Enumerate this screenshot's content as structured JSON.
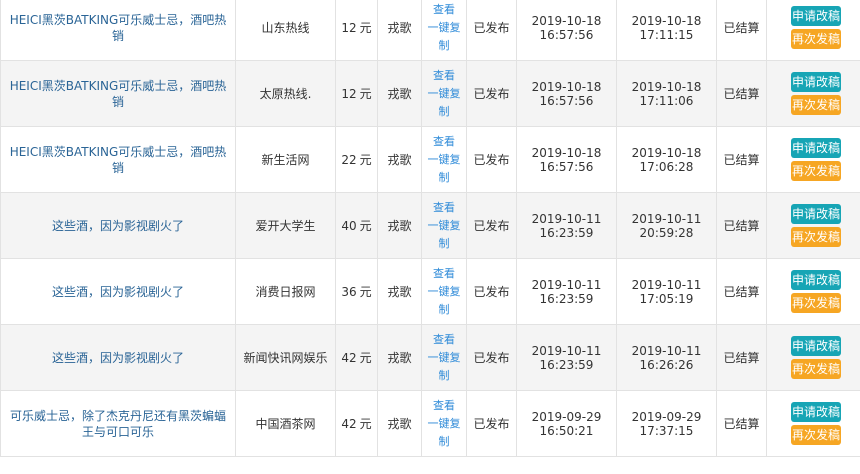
{
  "labels": {
    "view": "查看",
    "copy_line1": "一键",
    "copy_line2": "复",
    "copy_line3": "制",
    "request_edit": "申请改稿",
    "resend": "再次发稿"
  },
  "rows": [
    {
      "title": "HEICI黑茨BATKING可乐威士忌，酒吧热销",
      "media": "山东热线",
      "price": "12",
      "unit": "元",
      "user": "戎歌",
      "status": "已发布",
      "submit_date": "2019-10-18",
      "submit_time": "16:57:56",
      "publish_date": "2019-10-18",
      "publish_time": "17:11:15",
      "settle": "已结算"
    },
    {
      "title": "HEICI黑茨BATKING可乐威士忌，酒吧热销",
      "media": "太原热线.",
      "price": "12",
      "unit": "元",
      "user": "戎歌",
      "status": "已发布",
      "submit_date": "2019-10-18",
      "submit_time": "16:57:56",
      "publish_date": "2019-10-18",
      "publish_time": "17:11:06",
      "settle": "已结算"
    },
    {
      "title": "HEICI黑茨BATKING可乐威士忌，酒吧热销",
      "media": "新生活网",
      "price": "22",
      "unit": "元",
      "user": "戎歌",
      "status": "已发布",
      "submit_date": "2019-10-18",
      "submit_time": "16:57:56",
      "publish_date": "2019-10-18",
      "publish_time": "17:06:28",
      "settle": "已结算"
    },
    {
      "title": "这些酒，因为影视剧火了",
      "media": "爱开大学生",
      "price": "40",
      "unit": "元",
      "user": "戎歌",
      "status": "已发布",
      "submit_date": "2019-10-11",
      "submit_time": "16:23:59",
      "publish_date": "2019-10-11",
      "publish_time": "20:59:28",
      "settle": "已结算"
    },
    {
      "title": "这些酒，因为影视剧火了",
      "media": "消费日报网",
      "price": "36",
      "unit": "元",
      "user": "戎歌",
      "status": "已发布",
      "submit_date": "2019-10-11",
      "submit_time": "16:23:59",
      "publish_date": "2019-10-11",
      "publish_time": "17:05:19",
      "settle": "已结算"
    },
    {
      "title": "这些酒，因为影视剧火了",
      "media": "新闻快讯网娱乐",
      "price": "42",
      "unit": "元",
      "user": "戎歌",
      "status": "已发布",
      "submit_date": "2019-10-11",
      "submit_time": "16:23:59",
      "publish_date": "2019-10-11",
      "publish_time": "16:26:26",
      "settle": "已结算"
    },
    {
      "title": "可乐威士忌，除了杰克丹尼还有黑茨蝙蝠王与可口可乐",
      "media": "中国酒茶网",
      "price": "42",
      "unit": "元",
      "user": "戎歌",
      "status": "已发布",
      "submit_date": "2019-09-29",
      "submit_time": "16:50:21",
      "publish_date": "2019-09-29",
      "publish_time": "17:37:15",
      "settle": "已结算"
    }
  ]
}
